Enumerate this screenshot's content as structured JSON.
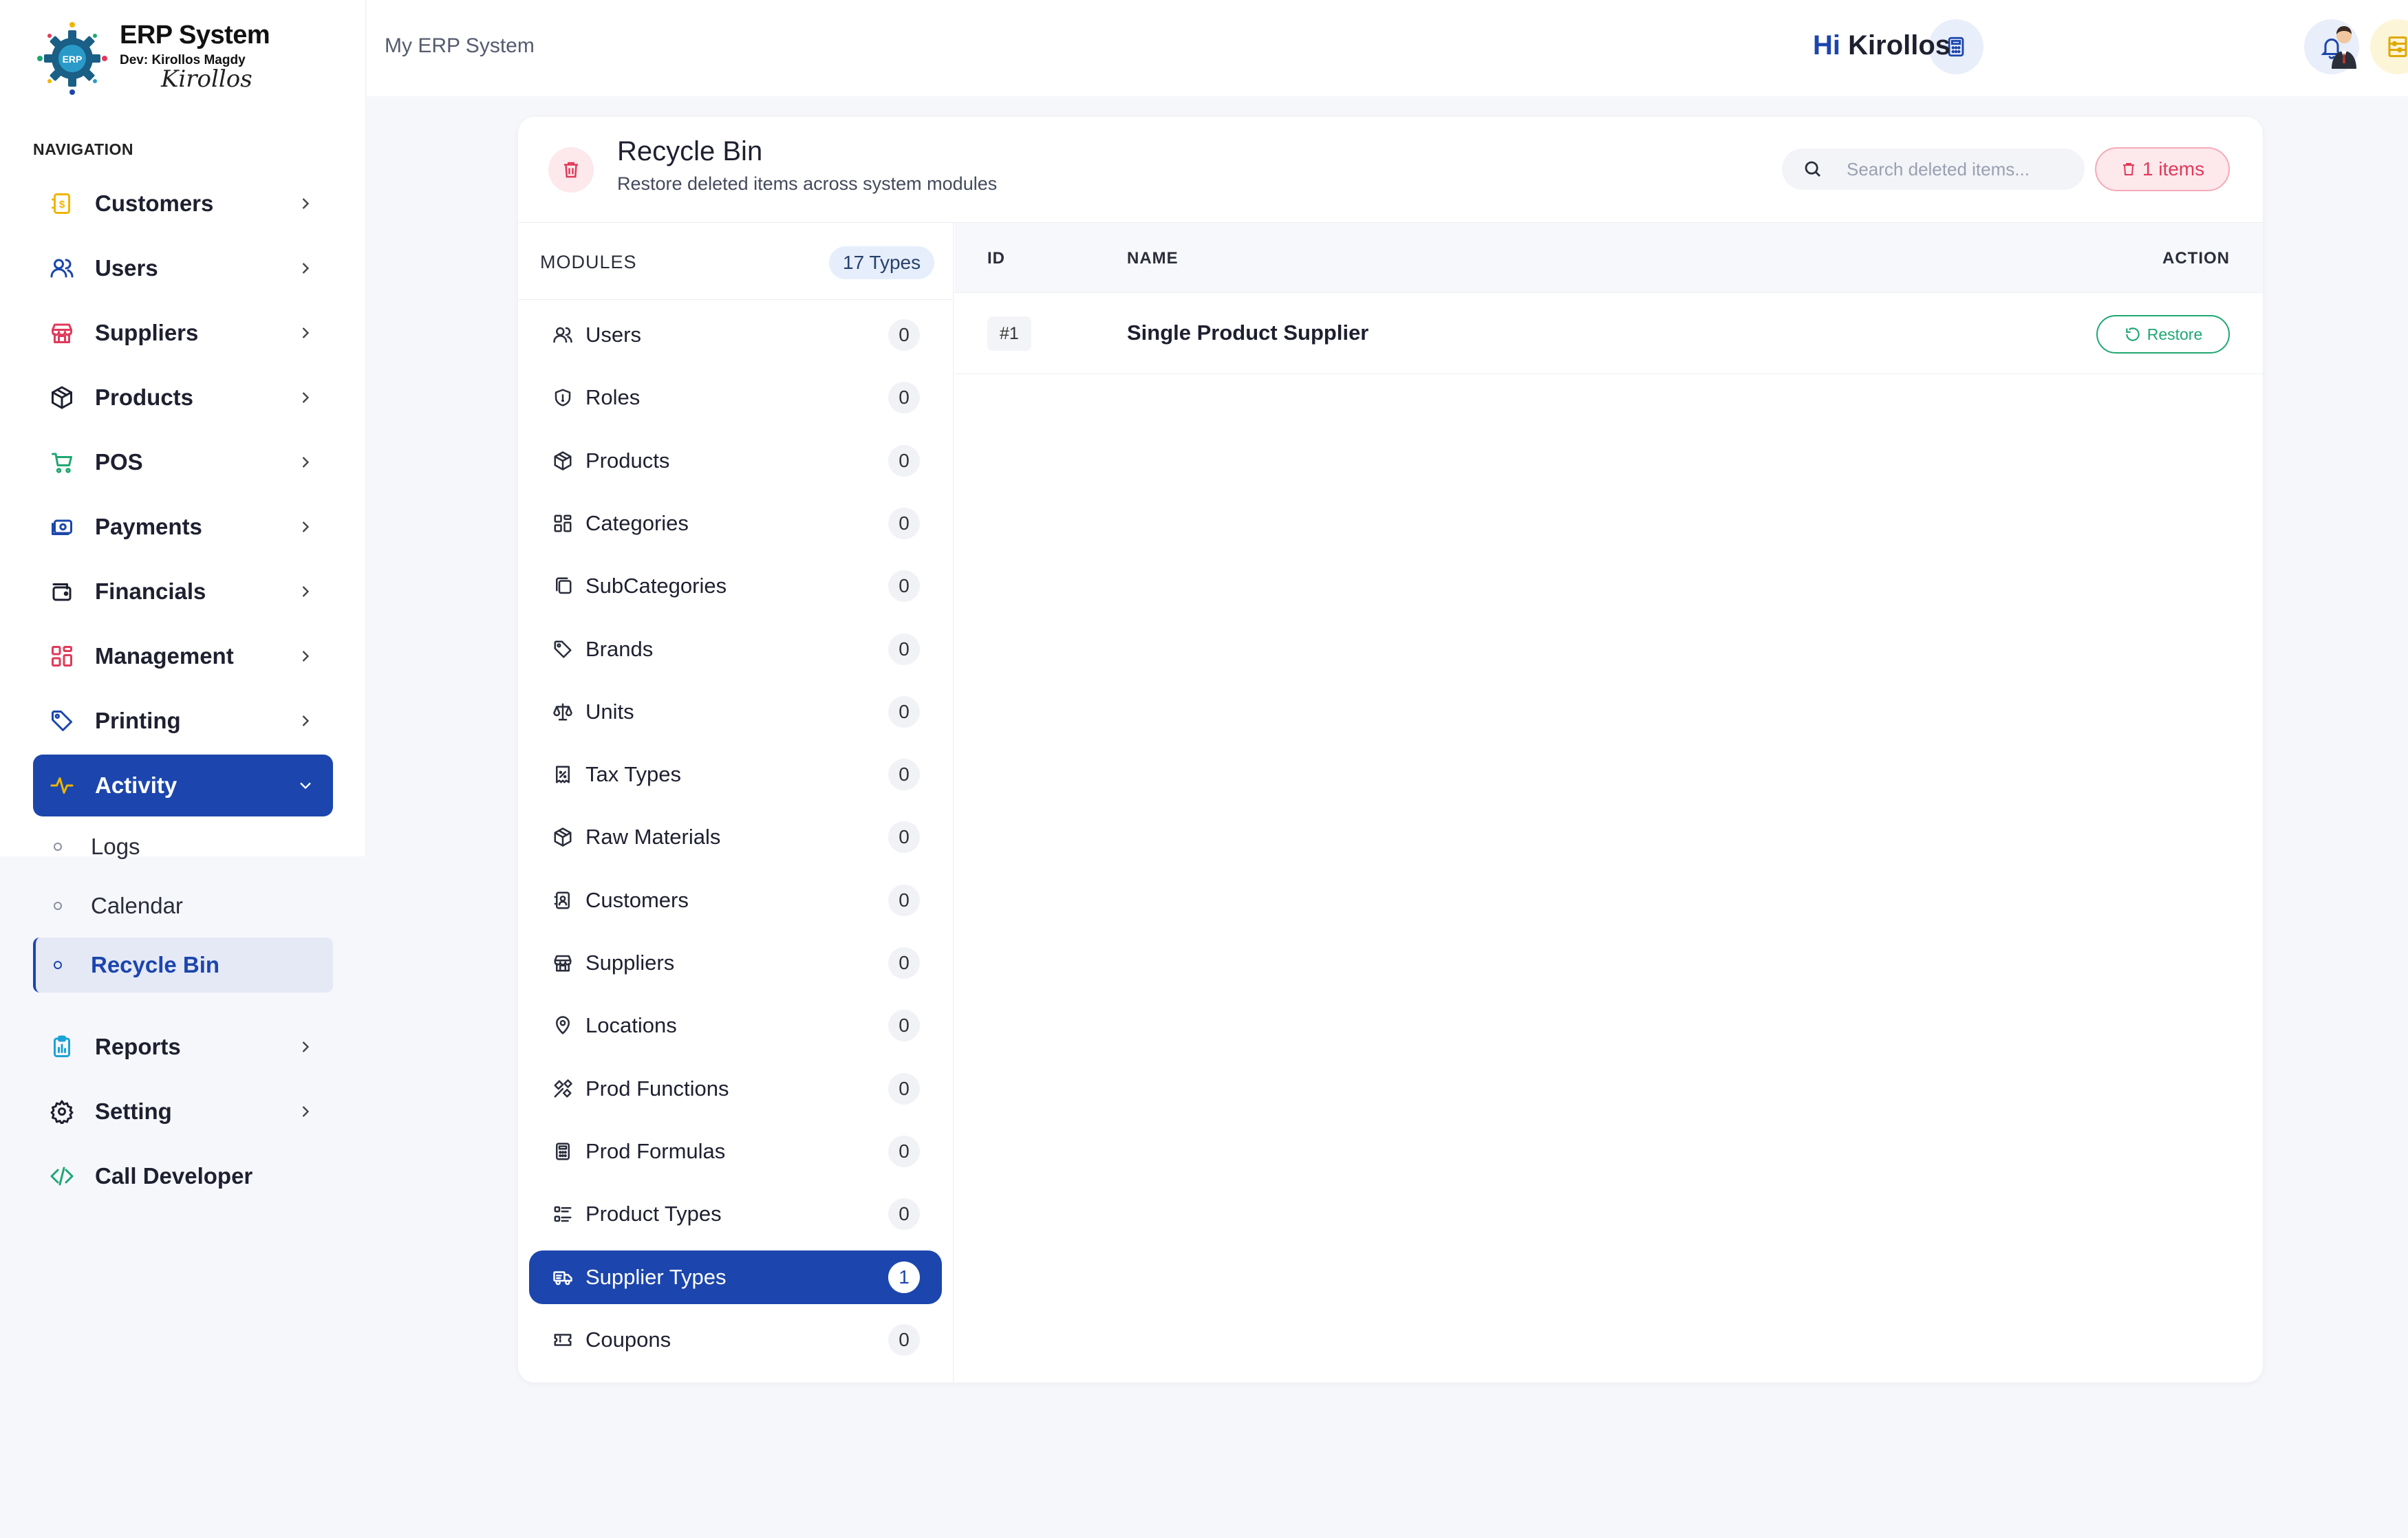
{
  "app": {
    "logo_badge": "ERP",
    "name": "ERP System",
    "dev": "Dev: Kirollos Magdy",
    "signature": "Kirollos"
  },
  "sidebar": {
    "heading": "NAVIGATION",
    "items": [
      {
        "label": "Customers",
        "icon": "customers-icon",
        "color": "#f0b400"
      },
      {
        "label": "Users",
        "icon": "users-icon",
        "color": "#1c46ad"
      },
      {
        "label": "Suppliers",
        "icon": "store-icon",
        "color": "#e03a5a"
      },
      {
        "label": "Products",
        "icon": "box-icon",
        "color": "#1e2030"
      },
      {
        "label": "POS",
        "icon": "cart-icon",
        "color": "#1fa773"
      },
      {
        "label": "Payments",
        "icon": "payments-icon",
        "color": "#1c46ad"
      },
      {
        "label": "Financials",
        "icon": "wallet-icon",
        "color": "#1e2030"
      },
      {
        "label": "Management",
        "icon": "grid-icon",
        "color": "#e03a5a"
      },
      {
        "label": "Printing",
        "icon": "tag-icon",
        "color": "#1c46ad"
      },
      {
        "label": "Activity",
        "icon": "pulse-icon",
        "color": "#f0b400"
      }
    ],
    "sub_items": [
      "Logs",
      "Calendar",
      "Recycle Bin"
    ],
    "bottom_items": [
      {
        "label": "Reports",
        "icon": "report-icon",
        "color": "#1aa3d6"
      },
      {
        "label": "Setting",
        "icon": "gear-icon",
        "color": "#1e2030"
      },
      {
        "label": "Call Developer",
        "icon": "code-icon",
        "color": "#1fa773"
      }
    ]
  },
  "topbar": {
    "title": "My ERP System",
    "greeting_hi": "Hi",
    "greeting_name": "Kirollos"
  },
  "recycle_bin": {
    "title": "Recycle Bin",
    "subtitle": "Restore deleted items across system modules",
    "search_placeholder": "Search deleted items...",
    "items_badge": "1 items"
  },
  "modules": {
    "heading": "MODULES",
    "types_badge": "17 Types",
    "list": [
      {
        "label": "Users",
        "count": "0",
        "icon": "users-icon"
      },
      {
        "label": "Roles",
        "count": "0",
        "icon": "shield-icon"
      },
      {
        "label": "Products",
        "count": "0",
        "icon": "box-icon"
      },
      {
        "label": "Categories",
        "count": "0",
        "icon": "grid-icon"
      },
      {
        "label": "SubCategories",
        "count": "0",
        "icon": "copy-icon"
      },
      {
        "label": "Brands",
        "count": "0",
        "icon": "tag-icon"
      },
      {
        "label": "Units",
        "count": "0",
        "icon": "scale-icon"
      },
      {
        "label": "Tax Types",
        "count": "0",
        "icon": "receipt-icon"
      },
      {
        "label": "Raw Materials",
        "count": "0",
        "icon": "box-icon"
      },
      {
        "label": "Customers",
        "count": "0",
        "icon": "contact-icon"
      },
      {
        "label": "Suppliers",
        "count": "0",
        "icon": "store-icon"
      },
      {
        "label": "Locations",
        "count": "0",
        "icon": "pin-icon"
      },
      {
        "label": "Prod Functions",
        "count": "0",
        "icon": "tools-icon"
      },
      {
        "label": "Prod Formulas",
        "count": "0",
        "icon": "calculator-icon"
      },
      {
        "label": "Product Types",
        "count": "0",
        "icon": "list-icon"
      },
      {
        "label": "Supplier Types",
        "count": "1",
        "icon": "truck-icon"
      },
      {
        "label": "Coupons",
        "count": "0",
        "icon": "ticket-icon"
      }
    ]
  },
  "table": {
    "headers": {
      "id": "ID",
      "name": "NAME",
      "action": "ACTION"
    },
    "rows": [
      {
        "id": "#1",
        "name": "Single Product Supplier",
        "action": "Restore"
      }
    ]
  }
}
